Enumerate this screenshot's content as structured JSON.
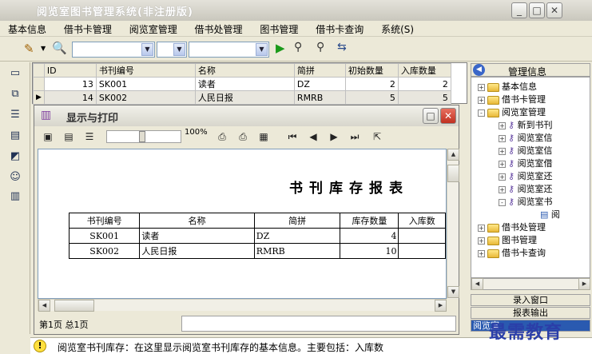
{
  "app": {
    "title": "阅览室图书管理系统(非注册版)"
  },
  "menu": [
    "基本信息",
    "借书卡管理",
    "阅览室管理",
    "借书处管理",
    "图书管理",
    "借书卡查询",
    "系统(S)"
  ],
  "grid": {
    "headers": [
      "ID",
      "书刊编号",
      "名称",
      "简拼",
      "初始数量",
      "入库数量"
    ],
    "rows": [
      [
        "13",
        "SK001",
        "读者",
        "DZ",
        "2",
        "2"
      ],
      [
        "14",
        "SK002",
        "人民日报",
        "RMRB",
        "5",
        "5"
      ]
    ]
  },
  "dialog": {
    "title": "显示与打印",
    "zoom": "100%",
    "report_title": "书刊库存报表",
    "report_headers": [
      "书刊编号",
      "名称",
      "简拼",
      "库存数量",
      "入库数"
    ],
    "report_rows": [
      [
        "SK001",
        "读者",
        "DZ",
        "4"
      ],
      [
        "SK002",
        "人民日报",
        "RMRB",
        "10"
      ]
    ],
    "page_info": "第1页 总1页"
  },
  "right_panel": {
    "title": "管理信息",
    "tree": [
      {
        "label": "基本信息",
        "level": 0,
        "expander": "+"
      },
      {
        "label": "借书卡管理",
        "level": 0,
        "expander": "+"
      },
      {
        "label": "阅览室管理",
        "level": 0,
        "expander": "-"
      },
      {
        "label": "新到书刊",
        "level": 1,
        "expander": "+"
      },
      {
        "label": "阅览室信",
        "level": 1,
        "expander": "+"
      },
      {
        "label": "阅览室信",
        "level": 1,
        "expander": "+"
      },
      {
        "label": "阅览室借",
        "level": 1,
        "expander": "+"
      },
      {
        "label": "阅览室还",
        "level": 1,
        "expander": "+"
      },
      {
        "label": "阅览室还",
        "level": 1,
        "expander": "+"
      },
      {
        "label": "阅览室书",
        "level": 1,
        "expander": "-"
      },
      {
        "label": "阅",
        "level": 2,
        "expander": ""
      },
      {
        "label": "借书处管理",
        "level": 0,
        "expander": "+"
      },
      {
        "label": "图书管理",
        "level": 0,
        "expander": "+"
      },
      {
        "label": "借书卡查询",
        "level": 0,
        "expander": "+"
      }
    ],
    "tabs": [
      "录入窗口",
      "报表输出",
      "阅览室"
    ]
  },
  "help_text": "阅览室书刊库存：在这里显示阅览室书刊库存的基本信息。主要包括：入库数",
  "watermark": "最需教育"
}
